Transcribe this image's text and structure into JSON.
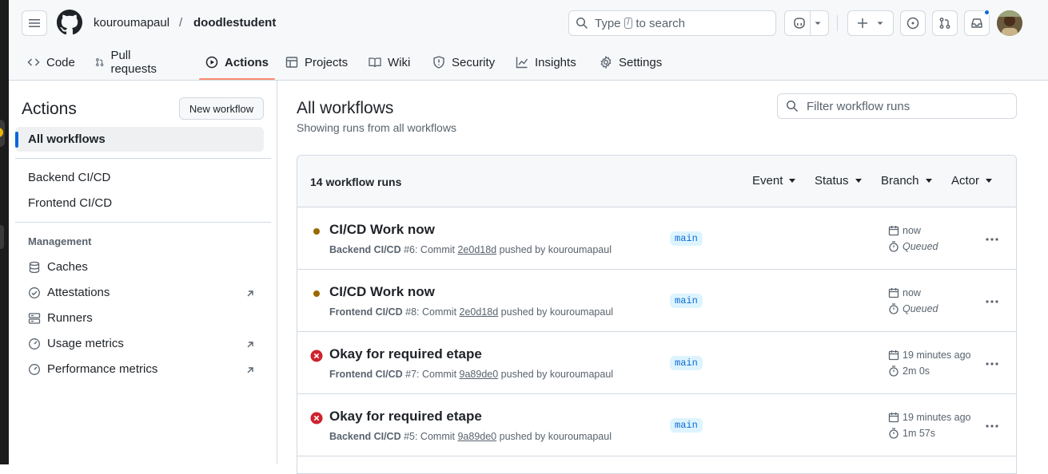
{
  "header": {
    "owner": "kouroumapaul",
    "separator": "/",
    "repo": "doodlestudent",
    "search_prefix": "Type",
    "search_key": "/",
    "search_suffix": "to search"
  },
  "tabs": [
    {
      "label": "Code",
      "icon": "code-icon"
    },
    {
      "label": "Pull requests",
      "icon": "pull-request-icon"
    },
    {
      "label": "Actions",
      "icon": "play-icon",
      "active": true
    },
    {
      "label": "Projects",
      "icon": "table-icon"
    },
    {
      "label": "Wiki",
      "icon": "book-icon"
    },
    {
      "label": "Security",
      "icon": "shield-icon"
    },
    {
      "label": "Insights",
      "icon": "graph-icon"
    },
    {
      "label": "Settings",
      "icon": "gear-icon"
    }
  ],
  "sidebar": {
    "title": "Actions",
    "new_workflow": "New workflow",
    "all_workflows": "All workflows",
    "workflows": [
      "Backend CI/CD",
      "Frontend CI/CD"
    ],
    "management_heading": "Management",
    "management": [
      {
        "label": "Caches",
        "icon": "database-icon"
      },
      {
        "label": "Attestations",
        "icon": "verified-icon",
        "external": true
      },
      {
        "label": "Runners",
        "icon": "server-icon"
      },
      {
        "label": "Usage metrics",
        "icon": "meter-icon",
        "external": true
      },
      {
        "label": "Performance metrics",
        "icon": "meter-icon",
        "external": true
      }
    ]
  },
  "main": {
    "title": "All workflows",
    "subtitle": "Showing runs from all workflows",
    "filter_placeholder": "Filter workflow runs",
    "runs_count": "14 workflow runs",
    "filters": [
      "Event",
      "Status",
      "Branch",
      "Actor"
    ],
    "runs": [
      {
        "title": "CI/CD Work now",
        "status": "queued",
        "workflow": "Backend CI/CD",
        "run_number": " #6: Commit ",
        "sha": "2e0d18d",
        "pushed_by": " pushed by kouroumapaul",
        "branch": "main",
        "when": "now",
        "duration": "Queued"
      },
      {
        "title": "CI/CD Work now",
        "status": "queued",
        "workflow": "Frontend CI/CD",
        "run_number": " #8: Commit ",
        "sha": "2e0d18d",
        "pushed_by": " pushed by kouroumapaul",
        "branch": "main",
        "when": "now",
        "duration": "Queued"
      },
      {
        "title": "Okay for required etape",
        "status": "failure",
        "workflow": "Frontend CI/CD",
        "run_number": " #7: Commit ",
        "sha": "9a89de0",
        "pushed_by": " pushed by kouroumapaul",
        "branch": "main",
        "when": "19 minutes ago",
        "duration": "2m 0s"
      },
      {
        "title": "Okay for required etape",
        "status": "failure",
        "workflow": "Backend CI/CD",
        "run_number": " #5: Commit ",
        "sha": "9a89de0",
        "pushed_by": " pushed by kouroumapaul",
        "branch": "main",
        "when": "19 minutes ago",
        "duration": "1m 57s"
      }
    ]
  },
  "colors": {
    "accent": "#0969da",
    "tab_underline": "#fd8c73",
    "queued": "#9a6700",
    "failure": "#cf222e"
  }
}
